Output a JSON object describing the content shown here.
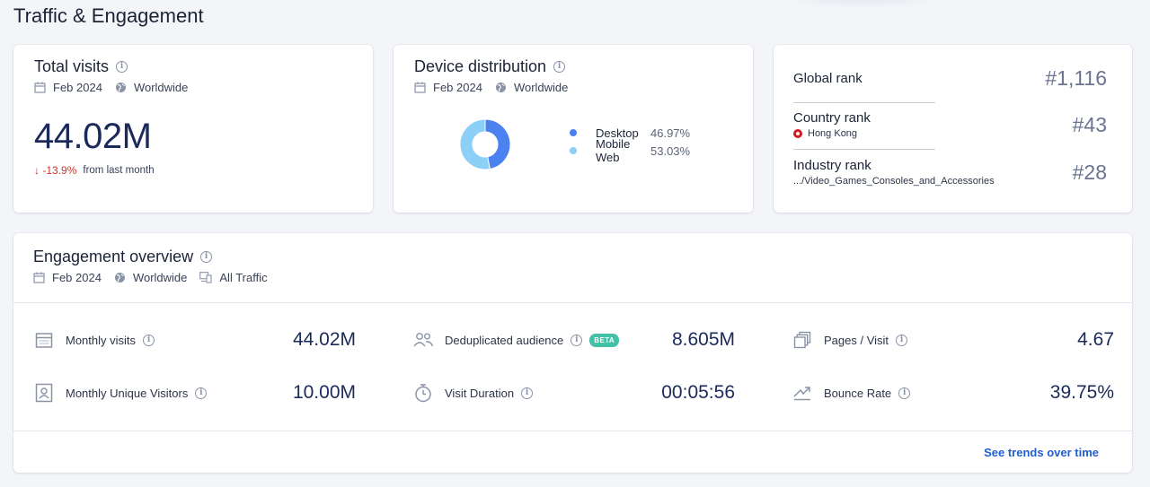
{
  "page": {
    "title": "Traffic & Engagement"
  },
  "total_visits": {
    "title": "Total visits",
    "period": "Feb 2024",
    "region": "Worldwide",
    "value": "44.02M",
    "change": "-13.9%",
    "change_caption": "from last month"
  },
  "device_distribution": {
    "title": "Device distribution",
    "period": "Feb 2024",
    "region": "Worldwide",
    "items": [
      {
        "label": "Desktop",
        "percent": "46.97%",
        "share": 46.97,
        "color": "#4c82f0"
      },
      {
        "label": "Mobile Web",
        "percent": "53.03%",
        "share": 53.03,
        "color": "#8ccff7"
      }
    ]
  },
  "ranks": {
    "global": {
      "label": "Global rank",
      "value": "#1,116"
    },
    "country": {
      "label": "Country rank",
      "sub": "Hong Kong",
      "value": "#43"
    },
    "industry": {
      "label": "Industry rank",
      "sub": ".../Video_Games_Consoles_and_Accessories",
      "value": "#28"
    }
  },
  "engagement": {
    "title": "Engagement overview",
    "period": "Feb 2024",
    "region": "Worldwide",
    "traffic": "All Traffic",
    "metrics": {
      "monthly_visits": {
        "label": "Monthly visits",
        "value": "44.02M",
        "icon": "calendar-icon"
      },
      "unique_visitors": {
        "label": "Monthly Unique Visitors",
        "value": "10.00M",
        "icon": "id-card-icon"
      },
      "dedup_audience": {
        "label": "Deduplicated audience",
        "badge": "BETA",
        "value": "8.605M",
        "icon": "users-icon"
      },
      "visit_duration": {
        "label": "Visit Duration",
        "value": "00:05:56",
        "icon": "stopwatch-icon"
      },
      "pages_per_visit": {
        "label": "Pages / Visit",
        "value": "4.67",
        "icon": "pages-icon"
      },
      "bounce_rate": {
        "label": "Bounce Rate",
        "value": "39.75%",
        "icon": "bounce-icon"
      }
    },
    "trends_link": "See trends over time"
  }
}
